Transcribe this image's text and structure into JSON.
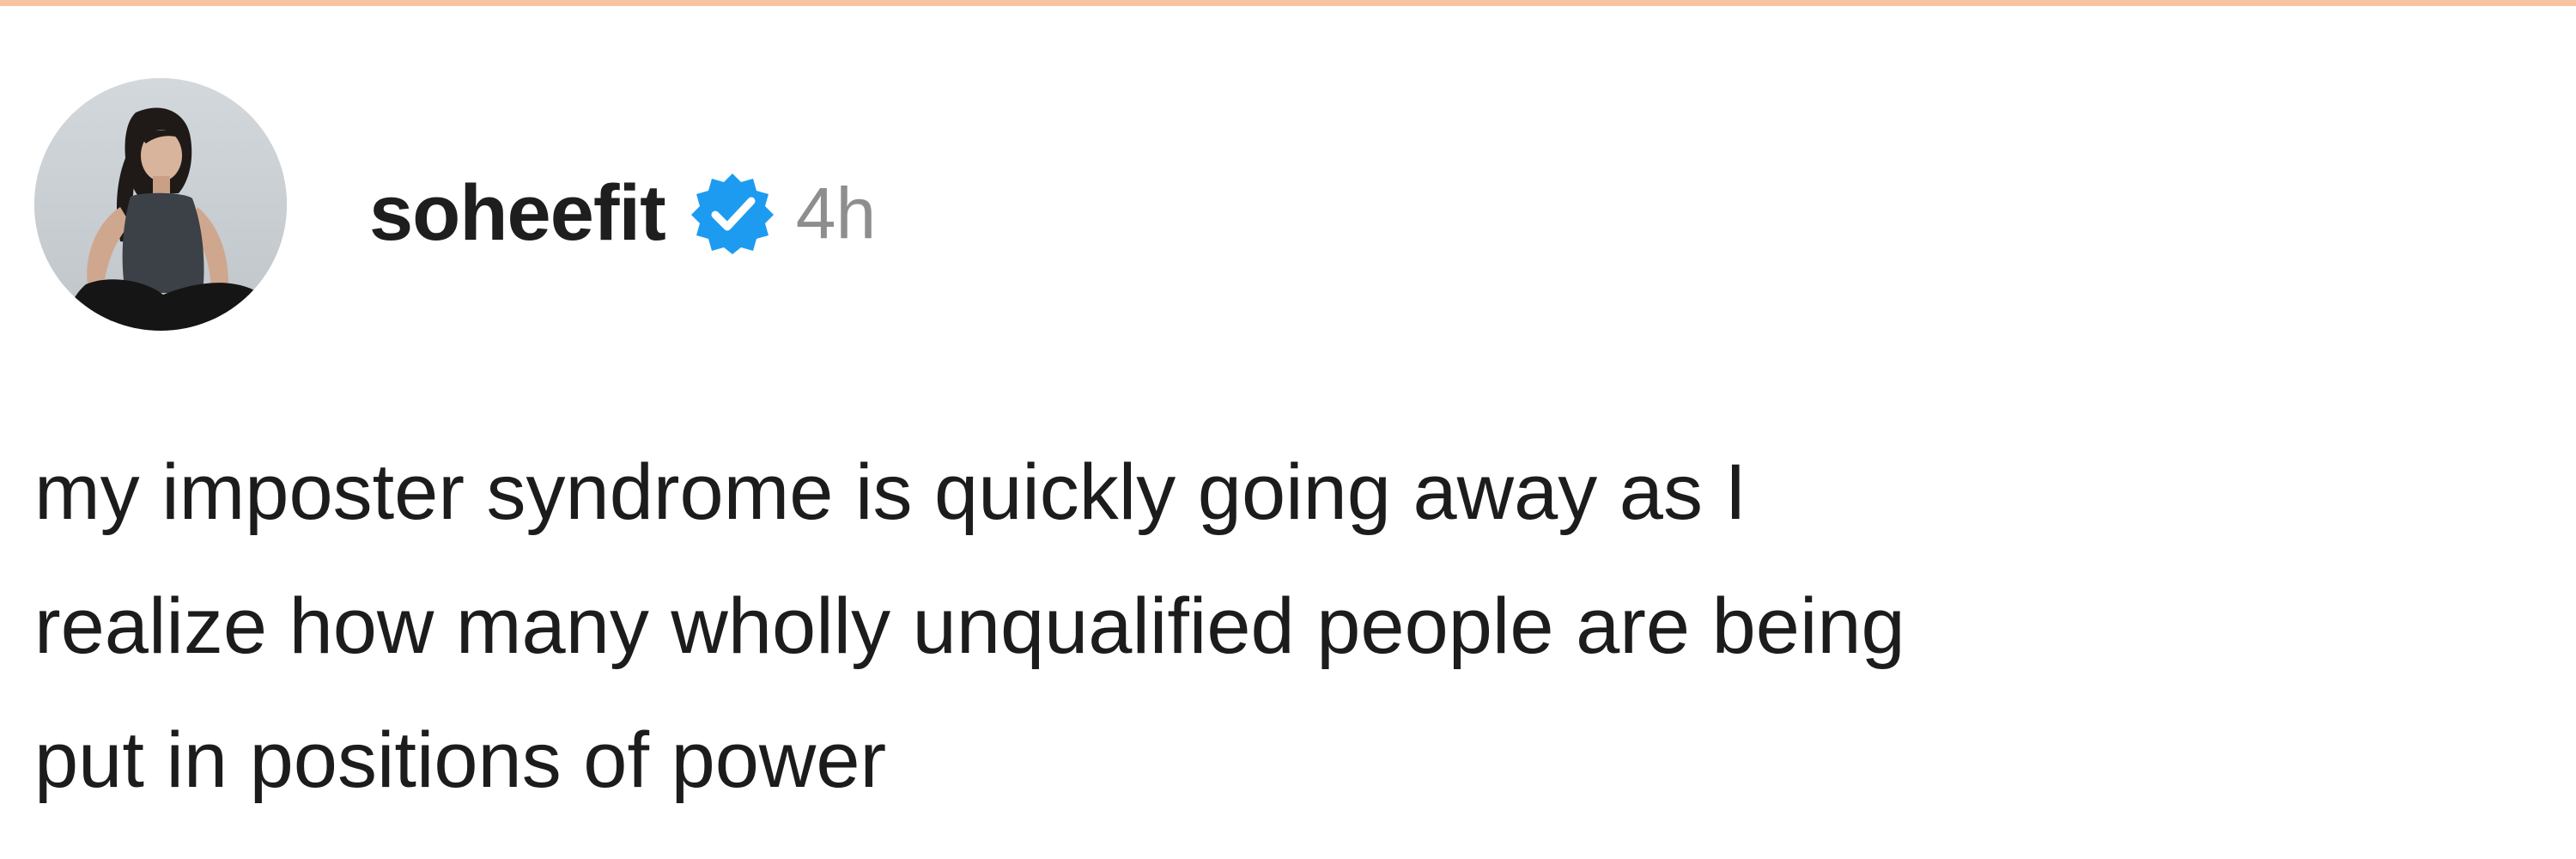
{
  "post": {
    "author": {
      "username": "soheefit",
      "verified": true,
      "avatar_icon": "profile-photo"
    },
    "timestamp": "4h",
    "text": {
      "line1": "my imposter syndrome is quickly going away as I",
      "line2": "realize how many wholly unqualified people are being",
      "line3": "put in positions of power"
    }
  },
  "colors": {
    "accent_border": "#f6c59f",
    "verified_badge": "#1d9bf0",
    "username_text": "#1e1e1e",
    "timestamp_text": "#8e8e8e",
    "body_text": "#1c1c1c"
  }
}
